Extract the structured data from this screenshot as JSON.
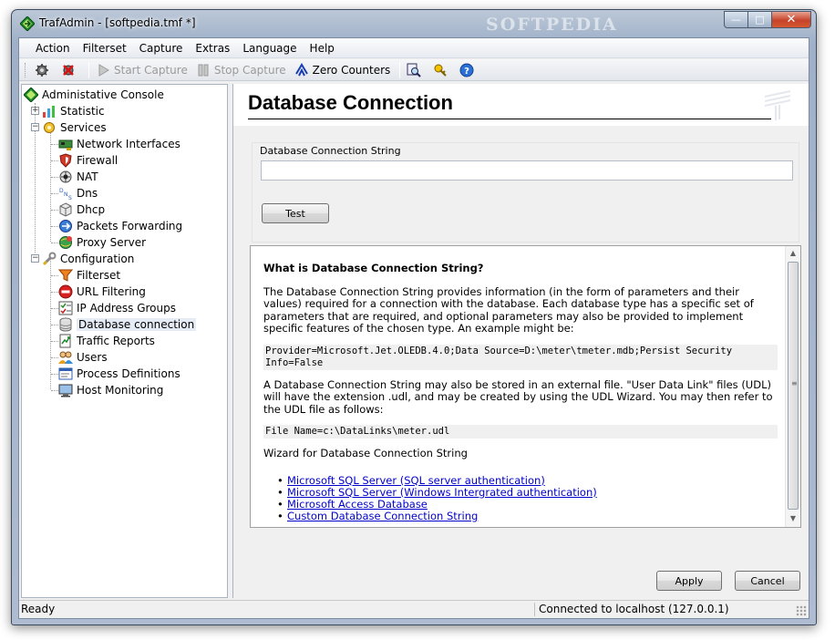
{
  "window": {
    "title": "TrafAdmin - [softpedia.tmf *]",
    "watermark": "SOFTPEDIA",
    "min_glyph": "—",
    "max_glyph": "□",
    "close_glyph": "✕"
  },
  "menu": [
    "Action",
    "Filterset",
    "Capture",
    "Extras",
    "Language",
    "Help"
  ],
  "toolbar": {
    "start_capture": "Start Capture",
    "stop_capture": "Stop Capture",
    "zero_counters": "Zero Counters"
  },
  "tree": {
    "root": "Administative Console",
    "statistic": "Statistic",
    "services": "Services",
    "service_items": [
      "Network Interfaces",
      "Firewall",
      "NAT",
      "Dns",
      "Dhcp",
      "Packets Forwarding",
      "Proxy Server"
    ],
    "configuration": "Configuration",
    "config_items": [
      "Filterset",
      "URL Filtering",
      "IP Address Groups",
      "Database connection",
      "Traffic Reports",
      "Users",
      "Process Definitions",
      "Host Monitoring"
    ],
    "selected": "Database connection"
  },
  "page": {
    "title": "Database Connection",
    "group_label": "Database Connection String",
    "conn_value": "",
    "test_label": "Test",
    "apply_label": "Apply",
    "cancel_label": "Cancel"
  },
  "help": {
    "heading": "What is Database Connection String?",
    "para1": "The Database Connection String provides information (in the form of parameters and their values) required for a connection with the database. Each database type has a specific set of parameters that are required, and optional parameters may also be provided to implement specific features of the chosen type. An example might be:",
    "code1": "Provider=Microsoft.Jet.OLEDB.4.0;Data Source=D:\\meter\\tmeter.mdb;Persist Security Info=False",
    "para2": "A Database Connection String may also be stored in an external file. \"User Data Link\" files (UDL) will have the extension .udl, and may be created by using the UDL Wizard. You may then refer to the UDL file as follows:",
    "code2": "File Name=c:\\DataLinks\\meter.udl",
    "wizard": "Wizard for Database Connection String",
    "links": [
      "Microsoft SQL Server (SQL server authentication)",
      "Microsoft SQL Server (Windows Intergrated authentication)",
      "Microsoft Access Database",
      "Custom Database Connection String"
    ]
  },
  "status": {
    "left": "Ready",
    "right": "Connected to localhost (127.0.0.1)"
  },
  "colors": {
    "link": "#0000cc",
    "selection": "#e6ecf5"
  }
}
